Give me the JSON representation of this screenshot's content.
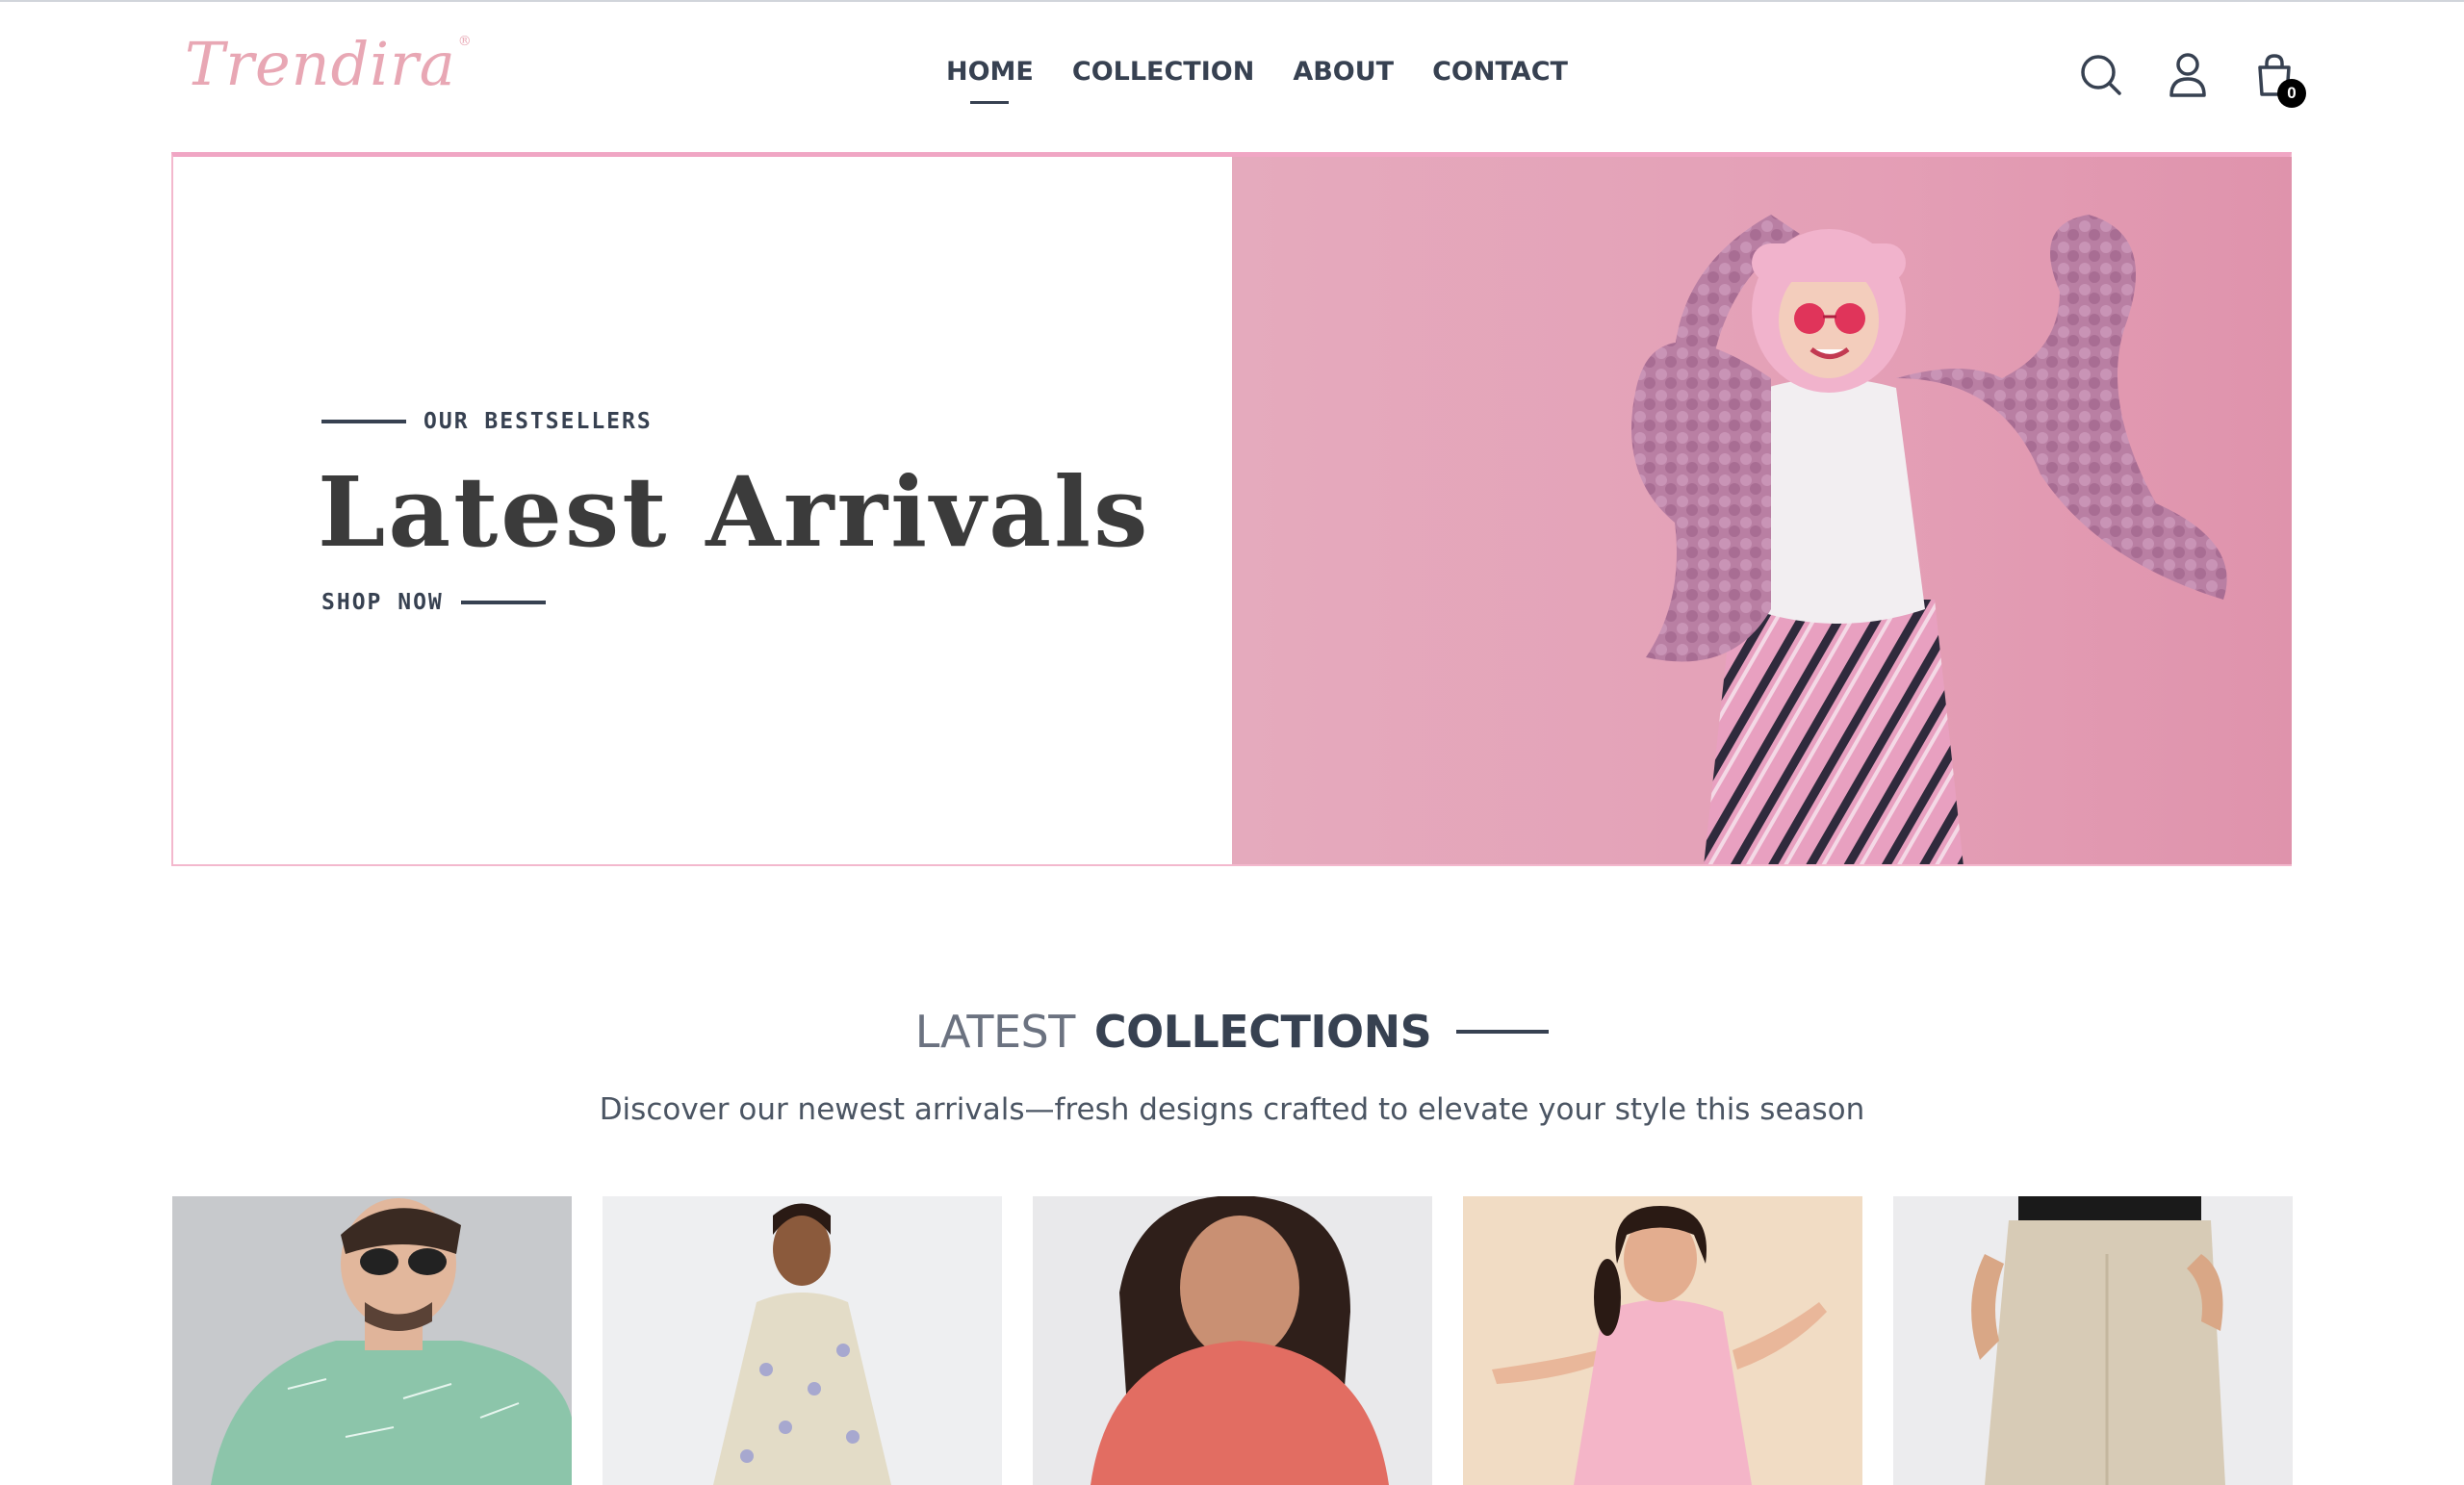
{
  "brand": {
    "logo_text": "Trendira",
    "registered": "®"
  },
  "nav": {
    "items": [
      {
        "label": "HOME",
        "active": true
      },
      {
        "label": "COLLECTION",
        "active": false
      },
      {
        "label": "ABOUT",
        "active": false
      },
      {
        "label": "CONTACT",
        "active": false
      }
    ]
  },
  "header_icons": {
    "search": "search-icon",
    "profile": "user-icon",
    "cart": "shopping-bag-icon",
    "cart_count": "0"
  },
  "hero": {
    "eyebrow": "OUR BESTSELLERS",
    "title": "Latest Arrivals",
    "cta": "SHOP NOW",
    "image_bg": "#e49fb6"
  },
  "collections": {
    "title_light": "LATEST",
    "title_bold": "COLLECTIONS",
    "subtitle": "Discover our newest arrivals—fresh designs crafted to elevate your style this season",
    "products": [
      {
        "image": "man-green-tshirt-sunglasses"
      },
      {
        "image": "girl-floral-dress"
      },
      {
        "image": "woman-coral-top"
      },
      {
        "image": "girl-pink-dress"
      },
      {
        "image": "beige-chinos"
      }
    ]
  },
  "colors": {
    "accent_pink": "#f0a6c4",
    "text_dark": "#374151"
  }
}
